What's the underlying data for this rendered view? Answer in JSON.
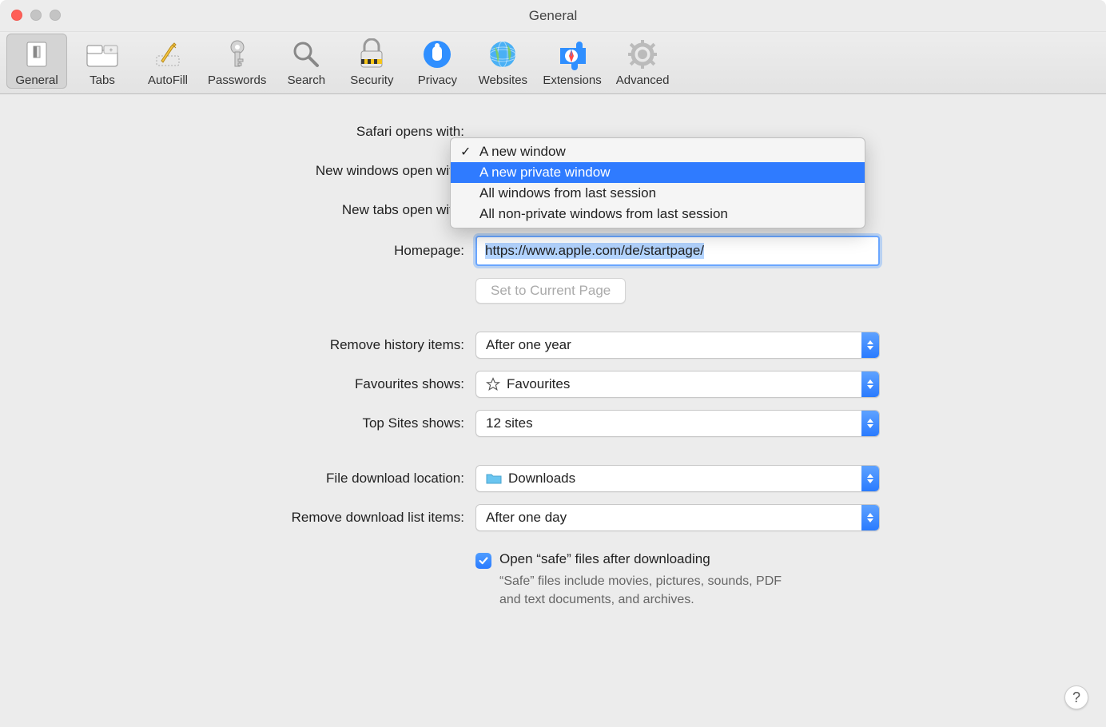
{
  "window": {
    "title": "General"
  },
  "toolbar": {
    "items": [
      {
        "label": "General"
      },
      {
        "label": "Tabs"
      },
      {
        "label": "AutoFill"
      },
      {
        "label": "Passwords"
      },
      {
        "label": "Search"
      },
      {
        "label": "Security"
      },
      {
        "label": "Privacy"
      },
      {
        "label": "Websites"
      },
      {
        "label": "Extensions"
      },
      {
        "label": "Advanced"
      }
    ]
  },
  "labels": {
    "safari_opens_with": "Safari opens with:",
    "new_windows_open_with": "New windows open with:",
    "new_tabs_open_with": "New tabs open with:",
    "homepage": "Homepage:",
    "set_current_page": "Set to Current Page",
    "remove_history": "Remove history items:",
    "favourites_shows": "Favourites shows:",
    "top_sites_shows": "Top Sites shows:",
    "file_download_location": "File download location:",
    "remove_download_list": "Remove download list items:",
    "open_safe_files": "Open “safe” files after downloading",
    "safe_files_desc": "“Safe” files include movies, pictures, sounds, PDF and text documents, and archives."
  },
  "values": {
    "homepage": "https://www.apple.com/de/startpage/",
    "remove_history": "After one year",
    "favourites_shows": "Favourites",
    "top_sites_shows": "12 sites",
    "file_download_location": "Downloads",
    "remove_download_list": "After one day",
    "open_safe_files_checked": true
  },
  "dropdown": {
    "options": [
      {
        "label": "A new window",
        "checked": true,
        "highlighted": false
      },
      {
        "label": "A new private window",
        "checked": false,
        "highlighted": true
      },
      {
        "label": "All windows from last session",
        "checked": false,
        "highlighted": false
      },
      {
        "label": "All non-private windows from last session",
        "checked": false,
        "highlighted": false
      }
    ]
  },
  "help": {
    "label": "?"
  }
}
